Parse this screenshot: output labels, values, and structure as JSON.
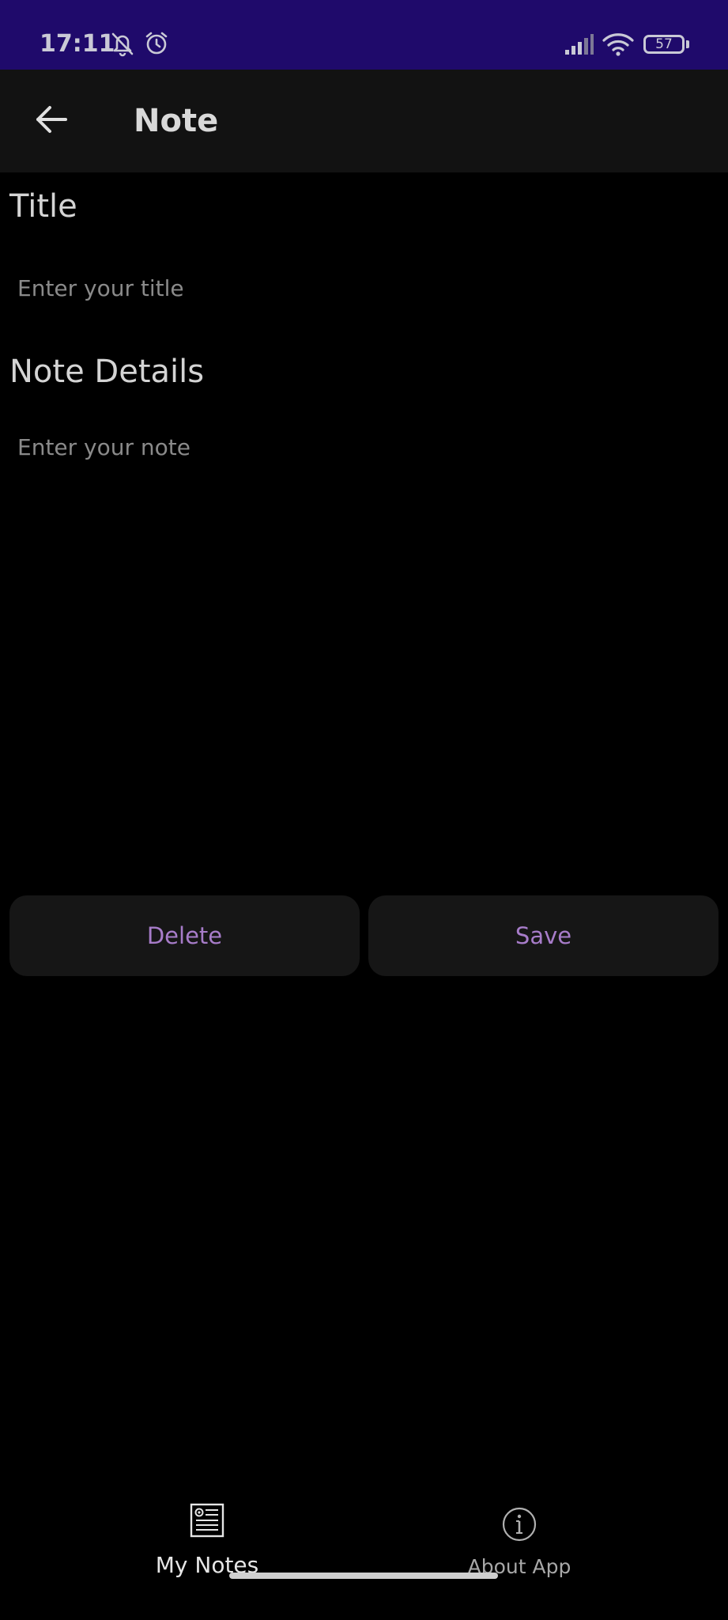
{
  "status_bar": {
    "time": "17:11",
    "battery": "57",
    "background": "#1f0a6b"
  },
  "app_bar": {
    "title": "Note",
    "back_icon": "arrow-left-icon"
  },
  "form": {
    "title_label": "Title",
    "title_placeholder": "Enter your title",
    "details_label": "Note Details",
    "details_placeholder": "Enter your note"
  },
  "actions": {
    "delete_label": "Delete",
    "save_label": "Save",
    "accent_color": "#a77cc9"
  },
  "bottom_nav": {
    "items": [
      {
        "label": "My Notes",
        "icon": "notes-icon",
        "active": true
      },
      {
        "label": "About App",
        "icon": "info-icon",
        "active": false
      }
    ]
  }
}
